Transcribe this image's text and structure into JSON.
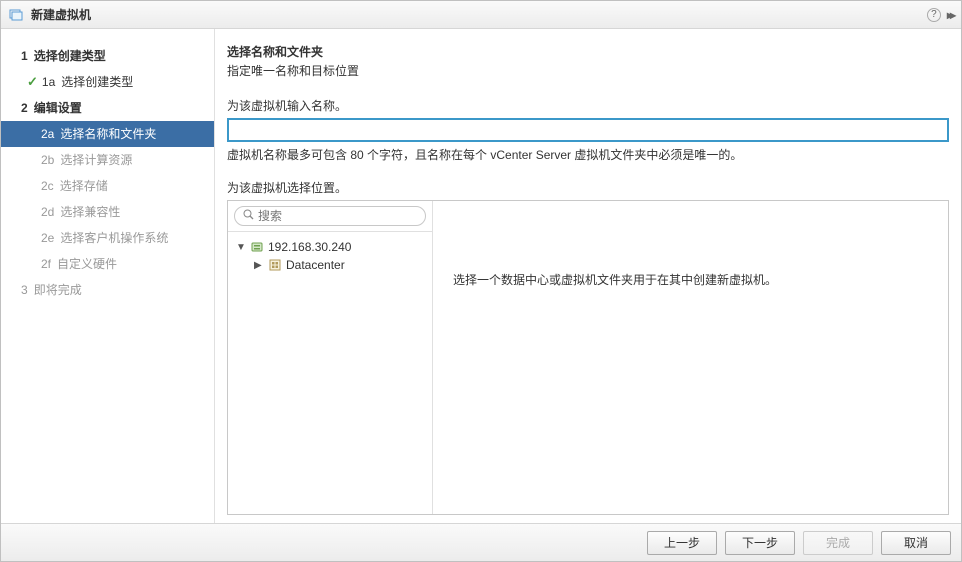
{
  "titlebar": {
    "title": "新建虚拟机",
    "help_icon": "?",
    "expand_icon": "▸▸"
  },
  "sidebar": {
    "steps": [
      {
        "num": "1",
        "label": "选择创建类型",
        "type": "main"
      },
      {
        "num": "1a",
        "label": "选择创建类型",
        "type": "sub",
        "state": "done",
        "checked": true
      },
      {
        "num": "2",
        "label": "编辑设置",
        "type": "main"
      },
      {
        "num": "2a",
        "label": "选择名称和文件夹",
        "type": "sub",
        "state": "active"
      },
      {
        "num": "2b",
        "label": "选择计算资源",
        "type": "sub"
      },
      {
        "num": "2c",
        "label": "选择存储",
        "type": "sub"
      },
      {
        "num": "2d",
        "label": "选择兼容性",
        "type": "sub"
      },
      {
        "num": "2e",
        "label": "选择客户机操作系统",
        "type": "sub"
      },
      {
        "num": "2f",
        "label": "自定义硬件",
        "type": "sub"
      },
      {
        "num": "3",
        "label": "即将完成",
        "type": "main-dim"
      }
    ]
  },
  "content": {
    "heading": "选择名称和文件夹",
    "subheading": "指定唯一名称和目标位置",
    "name_label": "为该虚拟机输入名称。",
    "name_value": "",
    "name_hint": "虚拟机名称最多可包含 80 个字符，且名称在每个 vCenter Server 虚拟机文件夹中必须是唯一的。",
    "location_label": "为该虚拟机选择位置。",
    "search_placeholder": "搜索",
    "tree": {
      "root": "192.168.30.240",
      "child": "Datacenter"
    },
    "right_hint": "选择一个数据中心或虚拟机文件夹用于在其中创建新虚拟机。"
  },
  "footer": {
    "back": "上一步",
    "next": "下一步",
    "finish": "完成",
    "cancel": "取消"
  }
}
